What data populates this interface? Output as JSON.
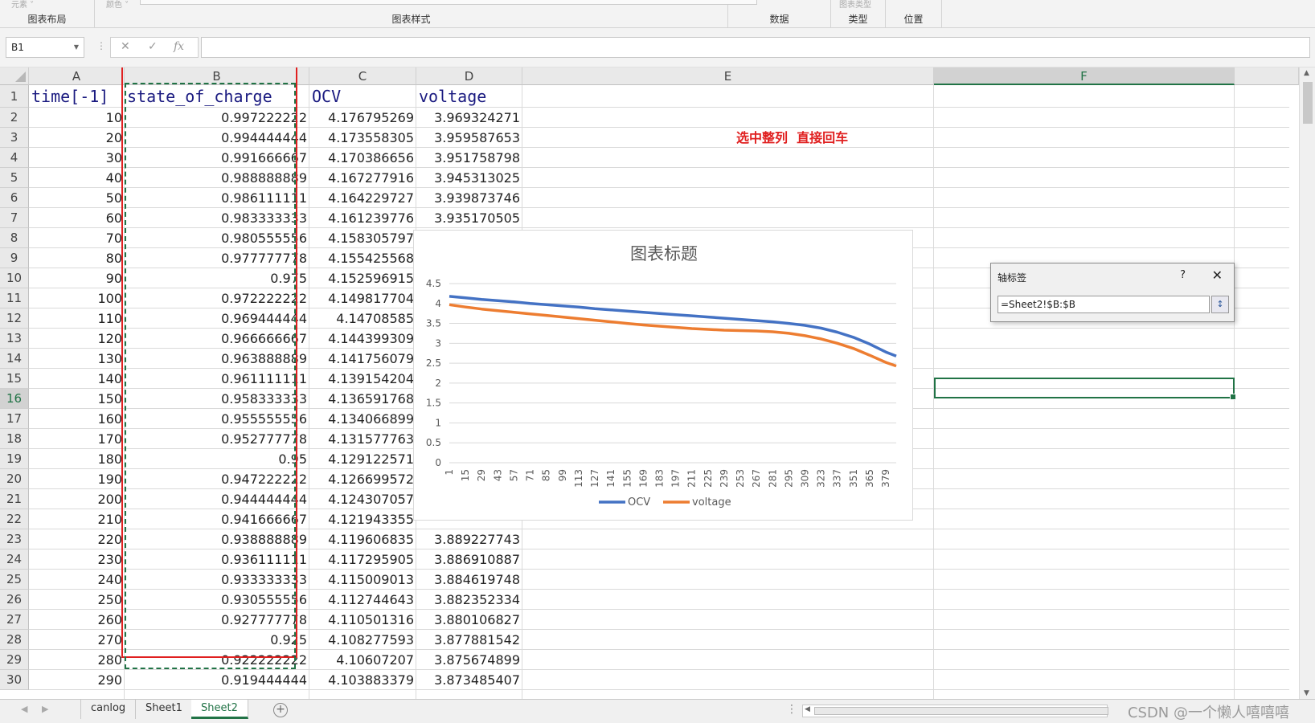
{
  "ribbon": {
    "groups": [
      {
        "faint": "元素 ˅",
        "label": "图表布局"
      },
      {
        "faint": "颜色 ˅",
        "label": "图表样式"
      },
      {
        "faint": "",
        "label": "数据"
      },
      {
        "faint": "图表类型",
        "label": "类型"
      },
      {
        "faint": "",
        "label": "位置"
      }
    ]
  },
  "formula_bar": {
    "name_box": "B1",
    "cancel_icon": "✕",
    "enter_icon": "✓",
    "fx_label": "fx",
    "formula": ""
  },
  "sheet": {
    "active_cell": "F16",
    "columns": [
      "A",
      "B",
      "C",
      "D",
      "E",
      "F"
    ],
    "rows": [
      "1",
      "2",
      "3",
      "4",
      "5",
      "6",
      "7",
      "8",
      "9",
      "10",
      "11",
      "12",
      "13",
      "14",
      "15",
      "16",
      "17",
      "18",
      "19",
      "20",
      "21",
      "22",
      "23",
      "24",
      "25",
      "26",
      "27",
      "28",
      "29",
      "30"
    ],
    "headers": [
      "time[-1]",
      "state_of_charge",
      "OCV",
      "voltage"
    ],
    "cells": [
      [
        "10",
        "0.997222222",
        "4.176795269",
        "3.969324271"
      ],
      [
        "20",
        "0.994444444",
        "4.173558305",
        "3.959587653"
      ],
      [
        "30",
        "0.991666667",
        "4.170386656",
        "3.951758798"
      ],
      [
        "40",
        "0.988888889",
        "4.167277916",
        "3.945313025"
      ],
      [
        "50",
        "0.986111111",
        "4.164229727",
        "3.939873746"
      ],
      [
        "60",
        "0.983333333",
        "4.161239776",
        "3.935170505"
      ],
      [
        "70",
        "0.980555556",
        "4.158305797",
        ""
      ],
      [
        "80",
        "0.977777778",
        "4.155425568",
        ""
      ],
      [
        "90",
        "0.975",
        "4.152596915",
        ""
      ],
      [
        "100",
        "0.972222222",
        "4.149817704",
        ""
      ],
      [
        "110",
        "0.969444444",
        "4.14708585",
        ""
      ],
      [
        "120",
        "0.966666667",
        "4.144399309",
        ""
      ],
      [
        "130",
        "0.963888889",
        "4.141756079",
        ""
      ],
      [
        "140",
        "0.961111111",
        "4.139154204",
        ""
      ],
      [
        "150",
        "0.958333333",
        "4.136591768",
        ""
      ],
      [
        "160",
        "0.955555556",
        "4.134066899",
        ""
      ],
      [
        "170",
        "0.952777778",
        "4.131577763",
        ""
      ],
      [
        "180",
        "0.95",
        "4.129122571",
        ""
      ],
      [
        "190",
        "0.947222222",
        "4.126699572",
        ""
      ],
      [
        "200",
        "0.944444444",
        "4.124307057",
        ""
      ],
      [
        "210",
        "0.941666667",
        "4.121943355",
        ""
      ],
      [
        "220",
        "0.938888889",
        "4.119606835",
        "3.889227743"
      ],
      [
        "230",
        "0.936111111",
        "4.117295905",
        "3.886910887"
      ],
      [
        "240",
        "0.933333333",
        "4.115009013",
        "3.884619748"
      ],
      [
        "250",
        "0.930555556",
        "4.112744643",
        "3.882352334"
      ],
      [
        "260",
        "0.927777778",
        "4.110501316",
        "3.880106827"
      ],
      [
        "270",
        "0.925",
        "4.108277593",
        "3.877881542"
      ],
      [
        "280",
        "0.922222222",
        "4.10607207",
        "3.875674899"
      ],
      [
        "290",
        "0.919444444",
        "4.103883379",
        "3.873485407"
      ]
    ],
    "note": "选中整列  直接回车"
  },
  "dialog": {
    "title": "轴标签",
    "help": "?",
    "close": "✕",
    "value": "=Sheet2!$B:$B",
    "collapse_icon": "↕"
  },
  "chart_data": {
    "type": "line",
    "title": "图表标题",
    "xlabel": "",
    "ylabel": "",
    "ylim": [
      0,
      4.5
    ],
    "yticks": [
      0,
      0.5,
      1,
      1.5,
      2,
      2.5,
      3,
      3.5,
      4,
      4.5
    ],
    "x_tick_labels": [
      "1",
      "15",
      "29",
      "43",
      "57",
      "71",
      "85",
      "99",
      "113",
      "127",
      "141",
      "155",
      "169",
      "183",
      "197",
      "211",
      "225",
      "239",
      "253",
      "267",
      "281",
      "295",
      "309",
      "323",
      "337",
      "351",
      "365",
      "379"
    ],
    "x_count": 388,
    "grid": true,
    "legend_position": "bottom",
    "series": [
      {
        "name": "OCV",
        "color": "#4472c4",
        "x": [
          1,
          15,
          29,
          43,
          57,
          71,
          85,
          99,
          113,
          127,
          141,
          155,
          169,
          183,
          197,
          211,
          225,
          239,
          253,
          267,
          281,
          295,
          309,
          323,
          337,
          351,
          365,
          379,
          388
        ],
        "values": [
          4.18,
          4.14,
          4.1,
          4.07,
          4.04,
          4.0,
          3.97,
          3.94,
          3.91,
          3.87,
          3.84,
          3.81,
          3.78,
          3.75,
          3.72,
          3.69,
          3.66,
          3.63,
          3.6,
          3.57,
          3.54,
          3.5,
          3.45,
          3.38,
          3.28,
          3.15,
          2.98,
          2.78,
          2.68
        ]
      },
      {
        "name": "voltage",
        "color": "#ed7d31",
        "x": [
          1,
          15,
          29,
          43,
          57,
          71,
          85,
          99,
          113,
          127,
          141,
          155,
          169,
          183,
          197,
          211,
          225,
          239,
          253,
          267,
          281,
          295,
          309,
          323,
          337,
          351,
          365,
          379,
          388
        ],
        "values": [
          3.97,
          3.91,
          3.86,
          3.82,
          3.78,
          3.74,
          3.7,
          3.66,
          3.62,
          3.58,
          3.54,
          3.5,
          3.46,
          3.43,
          3.4,
          3.37,
          3.35,
          3.33,
          3.32,
          3.31,
          3.29,
          3.25,
          3.19,
          3.11,
          3.0,
          2.87,
          2.7,
          2.52,
          2.43
        ]
      }
    ]
  },
  "tabs": {
    "nav_prev": "◀",
    "nav_next": "▶",
    "items": [
      "canlog",
      "Sheet1",
      "Sheet2"
    ],
    "active": "Sheet2",
    "add": "+",
    "scroll_dots": "⋮",
    "scroll_left": "◀"
  },
  "watermark": "CSDN @一个懒人嘻嘻嘻",
  "colors": {
    "accent": "#217346",
    "red": "#e02020",
    "ocv": "#4472c4",
    "voltage": "#ed7d31"
  }
}
